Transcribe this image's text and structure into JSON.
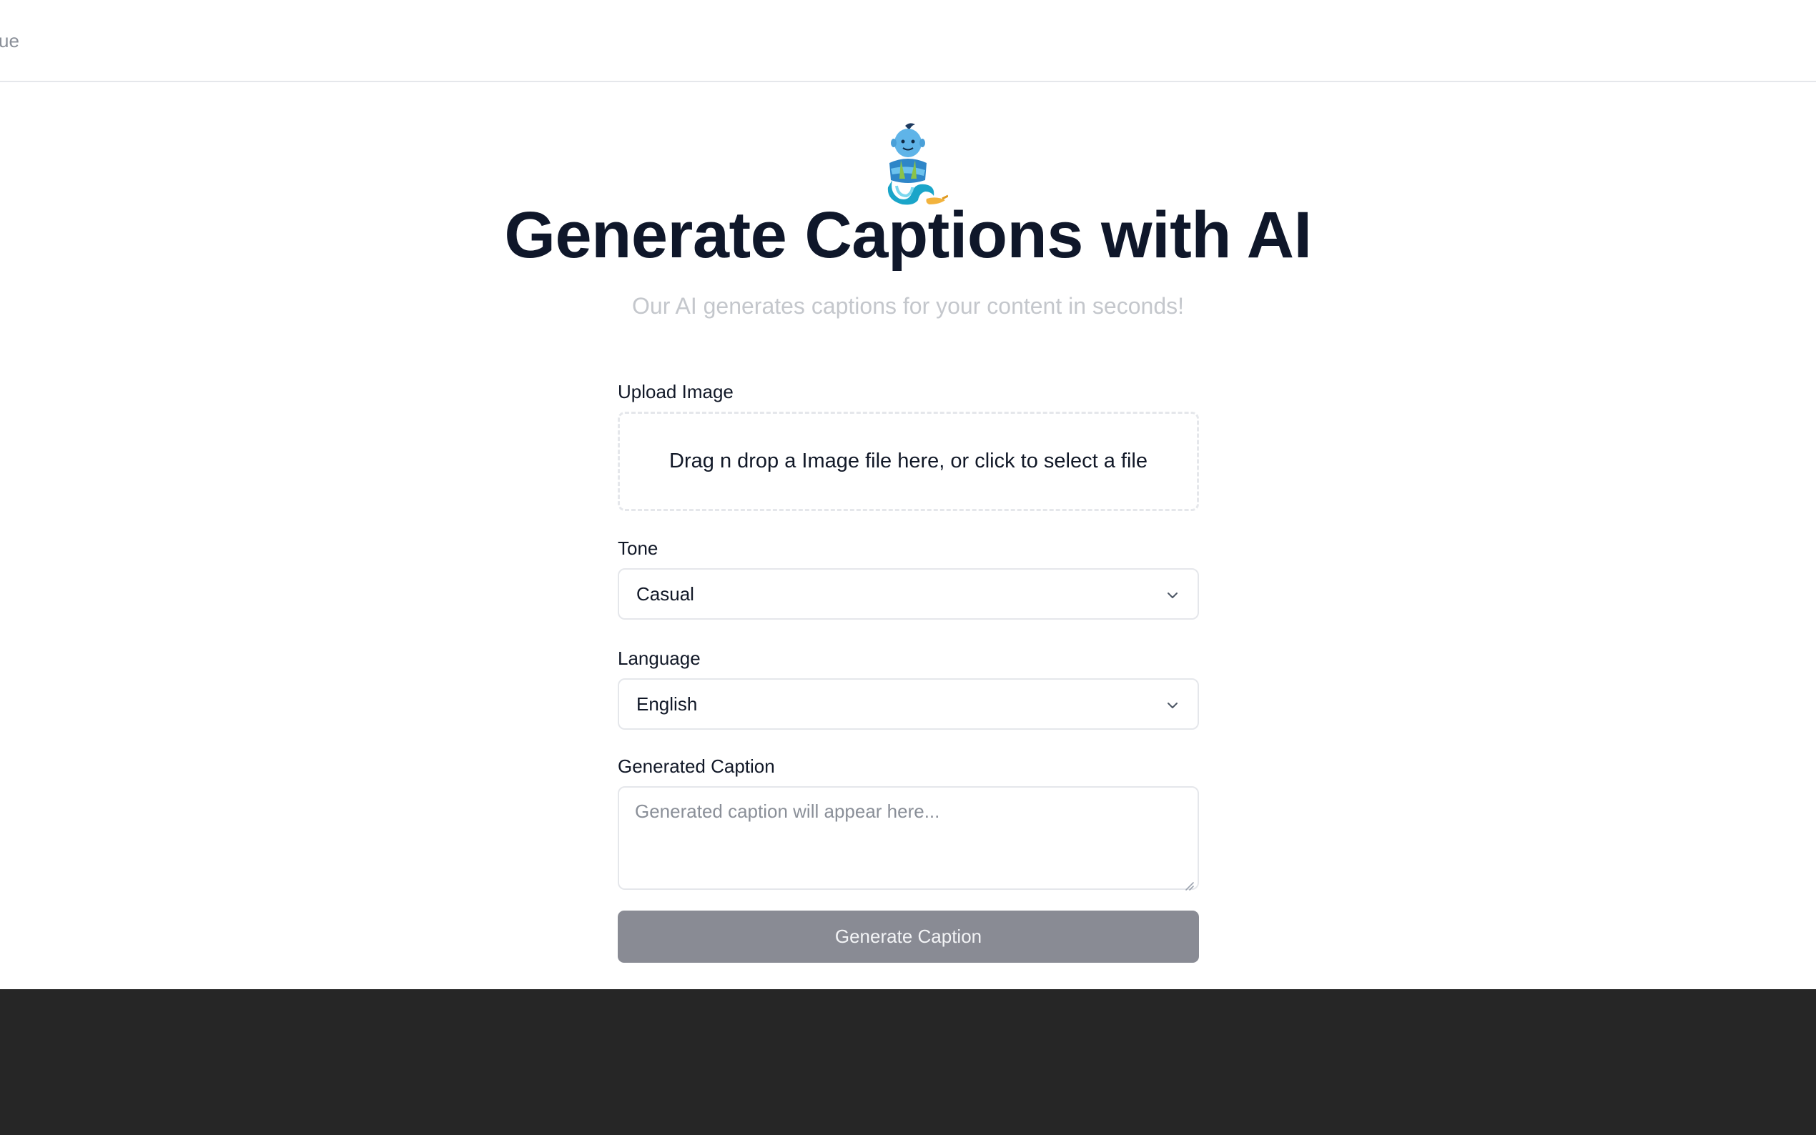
{
  "nav": {
    "partial_text": "ue"
  },
  "hero": {
    "icon": "genie-icon",
    "title": "Generate Captions with AI",
    "subtitle": "Our AI generates captions for your content in seconds!"
  },
  "form": {
    "upload": {
      "label": "Upload Image",
      "dropzone_text": "Drag n drop a Image file here, or click to select a file"
    },
    "tone": {
      "label": "Tone",
      "value": "Casual"
    },
    "language": {
      "label": "Language",
      "value": "English"
    },
    "caption": {
      "label": "Generated Caption",
      "placeholder": "Generated caption will appear here..."
    },
    "button_label": "Generate Caption"
  },
  "colors": {
    "title": "#0f172a",
    "subtitle": "#c4c7cc",
    "button_bg": "#898b94",
    "footer_bg": "#262626"
  }
}
